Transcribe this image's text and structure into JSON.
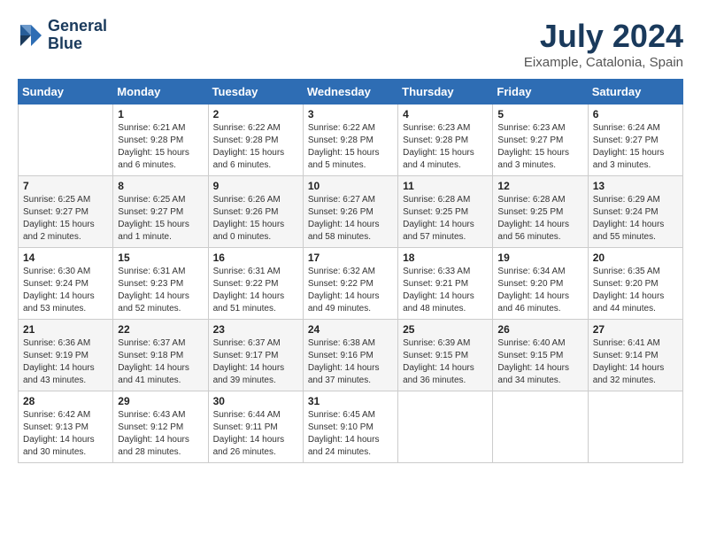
{
  "header": {
    "logo_line1": "General",
    "logo_line2": "Blue",
    "month": "July 2024",
    "location": "Eixample, Catalonia, Spain"
  },
  "weekdays": [
    "Sunday",
    "Monday",
    "Tuesday",
    "Wednesday",
    "Thursday",
    "Friday",
    "Saturday"
  ],
  "weeks": [
    [
      {
        "day": "",
        "content": ""
      },
      {
        "day": "1",
        "content": "Sunrise: 6:21 AM\nSunset: 9:28 PM\nDaylight: 15 hours\nand 6 minutes."
      },
      {
        "day": "2",
        "content": "Sunrise: 6:22 AM\nSunset: 9:28 PM\nDaylight: 15 hours\nand 6 minutes."
      },
      {
        "day": "3",
        "content": "Sunrise: 6:22 AM\nSunset: 9:28 PM\nDaylight: 15 hours\nand 5 minutes."
      },
      {
        "day": "4",
        "content": "Sunrise: 6:23 AM\nSunset: 9:28 PM\nDaylight: 15 hours\nand 4 minutes."
      },
      {
        "day": "5",
        "content": "Sunrise: 6:23 AM\nSunset: 9:27 PM\nDaylight: 15 hours\nand 3 minutes."
      },
      {
        "day": "6",
        "content": "Sunrise: 6:24 AM\nSunset: 9:27 PM\nDaylight: 15 hours\nand 3 minutes."
      }
    ],
    [
      {
        "day": "7",
        "content": "Sunrise: 6:25 AM\nSunset: 9:27 PM\nDaylight: 15 hours\nand 2 minutes."
      },
      {
        "day": "8",
        "content": "Sunrise: 6:25 AM\nSunset: 9:27 PM\nDaylight: 15 hours\nand 1 minute."
      },
      {
        "day": "9",
        "content": "Sunrise: 6:26 AM\nSunset: 9:26 PM\nDaylight: 15 hours\nand 0 minutes."
      },
      {
        "day": "10",
        "content": "Sunrise: 6:27 AM\nSunset: 9:26 PM\nDaylight: 14 hours\nand 58 minutes."
      },
      {
        "day": "11",
        "content": "Sunrise: 6:28 AM\nSunset: 9:25 PM\nDaylight: 14 hours\nand 57 minutes."
      },
      {
        "day": "12",
        "content": "Sunrise: 6:28 AM\nSunset: 9:25 PM\nDaylight: 14 hours\nand 56 minutes."
      },
      {
        "day": "13",
        "content": "Sunrise: 6:29 AM\nSunset: 9:24 PM\nDaylight: 14 hours\nand 55 minutes."
      }
    ],
    [
      {
        "day": "14",
        "content": "Sunrise: 6:30 AM\nSunset: 9:24 PM\nDaylight: 14 hours\nand 53 minutes."
      },
      {
        "day": "15",
        "content": "Sunrise: 6:31 AM\nSunset: 9:23 PM\nDaylight: 14 hours\nand 52 minutes."
      },
      {
        "day": "16",
        "content": "Sunrise: 6:31 AM\nSunset: 9:22 PM\nDaylight: 14 hours\nand 51 minutes."
      },
      {
        "day": "17",
        "content": "Sunrise: 6:32 AM\nSunset: 9:22 PM\nDaylight: 14 hours\nand 49 minutes."
      },
      {
        "day": "18",
        "content": "Sunrise: 6:33 AM\nSunset: 9:21 PM\nDaylight: 14 hours\nand 48 minutes."
      },
      {
        "day": "19",
        "content": "Sunrise: 6:34 AM\nSunset: 9:20 PM\nDaylight: 14 hours\nand 46 minutes."
      },
      {
        "day": "20",
        "content": "Sunrise: 6:35 AM\nSunset: 9:20 PM\nDaylight: 14 hours\nand 44 minutes."
      }
    ],
    [
      {
        "day": "21",
        "content": "Sunrise: 6:36 AM\nSunset: 9:19 PM\nDaylight: 14 hours\nand 43 minutes."
      },
      {
        "day": "22",
        "content": "Sunrise: 6:37 AM\nSunset: 9:18 PM\nDaylight: 14 hours\nand 41 minutes."
      },
      {
        "day": "23",
        "content": "Sunrise: 6:37 AM\nSunset: 9:17 PM\nDaylight: 14 hours\nand 39 minutes."
      },
      {
        "day": "24",
        "content": "Sunrise: 6:38 AM\nSunset: 9:16 PM\nDaylight: 14 hours\nand 37 minutes."
      },
      {
        "day": "25",
        "content": "Sunrise: 6:39 AM\nSunset: 9:15 PM\nDaylight: 14 hours\nand 36 minutes."
      },
      {
        "day": "26",
        "content": "Sunrise: 6:40 AM\nSunset: 9:15 PM\nDaylight: 14 hours\nand 34 minutes."
      },
      {
        "day": "27",
        "content": "Sunrise: 6:41 AM\nSunset: 9:14 PM\nDaylight: 14 hours\nand 32 minutes."
      }
    ],
    [
      {
        "day": "28",
        "content": "Sunrise: 6:42 AM\nSunset: 9:13 PM\nDaylight: 14 hours\nand 30 minutes."
      },
      {
        "day": "29",
        "content": "Sunrise: 6:43 AM\nSunset: 9:12 PM\nDaylight: 14 hours\nand 28 minutes."
      },
      {
        "day": "30",
        "content": "Sunrise: 6:44 AM\nSunset: 9:11 PM\nDaylight: 14 hours\nand 26 minutes."
      },
      {
        "day": "31",
        "content": "Sunrise: 6:45 AM\nSunset: 9:10 PM\nDaylight: 14 hours\nand 24 minutes."
      },
      {
        "day": "",
        "content": ""
      },
      {
        "day": "",
        "content": ""
      },
      {
        "day": "",
        "content": ""
      }
    ]
  ]
}
